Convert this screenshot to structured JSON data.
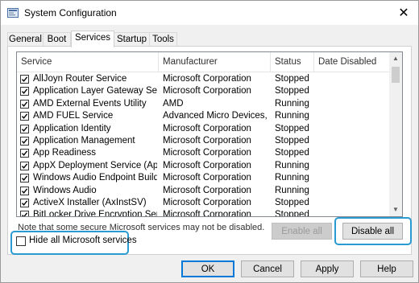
{
  "window": {
    "title": "System Configuration",
    "close_glyph": "✕"
  },
  "tabs": [
    {
      "label": "General"
    },
    {
      "label": "Boot"
    },
    {
      "label": "Services",
      "active": true
    },
    {
      "label": "Startup"
    },
    {
      "label": "Tools"
    }
  ],
  "columns": [
    "Service",
    "Manufacturer",
    "Status",
    "Date Disabled"
  ],
  "services": [
    {
      "name": "AllJoyn Router Service",
      "manufacturer": "Microsoft Corporation",
      "status": "Stopped",
      "date_disabled": "",
      "checked": true
    },
    {
      "name": "Application Layer Gateway Service",
      "manufacturer": "Microsoft Corporation",
      "status": "Stopped",
      "date_disabled": "",
      "checked": true
    },
    {
      "name": "AMD External Events Utility",
      "manufacturer": "AMD",
      "status": "Running",
      "date_disabled": "",
      "checked": true
    },
    {
      "name": "AMD FUEL Service",
      "manufacturer": "Advanced Micro Devices, I...",
      "status": "Running",
      "date_disabled": "",
      "checked": true
    },
    {
      "name": "Application Identity",
      "manufacturer": "Microsoft Corporation",
      "status": "Stopped",
      "date_disabled": "",
      "checked": true
    },
    {
      "name": "Application Management",
      "manufacturer": "Microsoft Corporation",
      "status": "Stopped",
      "date_disabled": "",
      "checked": true
    },
    {
      "name": "App Readiness",
      "manufacturer": "Microsoft Corporation",
      "status": "Stopped",
      "date_disabled": "",
      "checked": true
    },
    {
      "name": "AppX Deployment Service (AppX...",
      "manufacturer": "Microsoft Corporation",
      "status": "Running",
      "date_disabled": "",
      "checked": true
    },
    {
      "name": "Windows Audio Endpoint Builder",
      "manufacturer": "Microsoft Corporation",
      "status": "Running",
      "date_disabled": "",
      "checked": true
    },
    {
      "name": "Windows Audio",
      "manufacturer": "Microsoft Corporation",
      "status": "Running",
      "date_disabled": "",
      "checked": true
    },
    {
      "name": "ActiveX Installer (AxInstSV)",
      "manufacturer": "Microsoft Corporation",
      "status": "Stopped",
      "date_disabled": "",
      "checked": true
    },
    {
      "name": "BitLocker Drive Encryption Service",
      "manufacturer": "Microsoft Corporation",
      "status": "Stopped",
      "date_disabled": "",
      "checked": true
    }
  ],
  "note": "Note that some secure Microsoft services may not be disabled.",
  "buttons": {
    "enable_all": "Enable all",
    "disable_all": "Disable all",
    "ok": "OK",
    "cancel": "Cancel",
    "apply": "Apply",
    "help": "Help"
  },
  "hide_ms": {
    "label": "Hide all Microsoft services",
    "checked": false
  },
  "colors": {
    "highlight": "#2a9bd0",
    "accent": "#0078d7"
  }
}
